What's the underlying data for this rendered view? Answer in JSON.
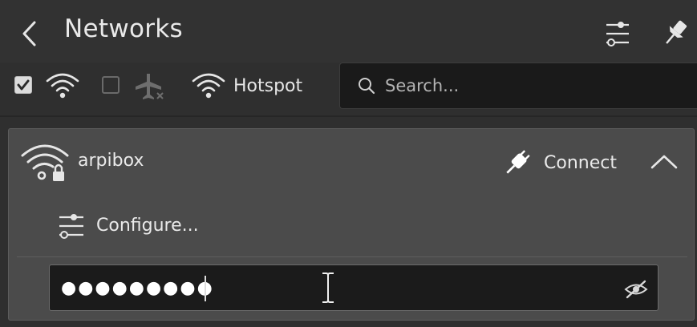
{
  "header": {
    "title": "Networks",
    "back_icon": "chevron-left-icon",
    "configure_icon": "configure-sliders-icon",
    "pin_icon": "pin-icon"
  },
  "toolbar": {
    "wifi_checkbox": {
      "checked": true,
      "icon": "wifi-icon"
    },
    "airplane_checkbox": {
      "checked": false,
      "icon": "airplane-mode-icon"
    },
    "hotspot_label": "Hotspot",
    "hotspot_icon": "wifi-hotspot-icon",
    "search": {
      "placeholder": "Search...",
      "value": "",
      "icon": "search-icon"
    }
  },
  "network": {
    "ssid": "arpibox",
    "icon": "wifi-locked-icon",
    "connect_label": "Connect",
    "connect_icon": "plug-connect-icon",
    "collapse_icon": "chevron-up-icon",
    "configure_label": "Configure...",
    "configure_icon": "configure-sliders-icon",
    "password_masked": "●●●●●●●●●",
    "reveal_icon": "eye-hidden-icon"
  },
  "colors": {
    "background": "#2f2f2f",
    "card": "#4b4b4b",
    "field": "#1a1a1a",
    "text": "#e6e6e6"
  }
}
